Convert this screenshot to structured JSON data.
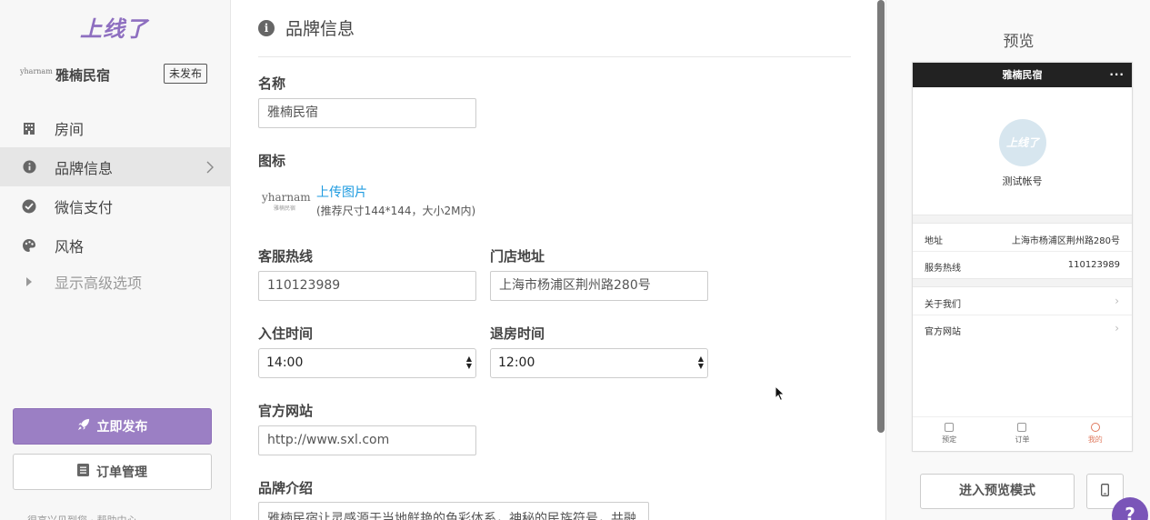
{
  "sidebar": {
    "logo": "上线了",
    "brand_mini": "yharnam",
    "brand_name": "雅楠民宿",
    "status_badge": "未发布",
    "items": [
      {
        "label": "房间",
        "icon": "building-icon"
      },
      {
        "label": "品牌信息",
        "icon": "info-icon",
        "active": true
      },
      {
        "label": "微信支付",
        "icon": "wechat-pay-icon"
      },
      {
        "label": "风格",
        "icon": "palette-icon"
      }
    ],
    "advanced_label": "显示高级选项",
    "publish_label": "立即发布",
    "orders_label": "订单管理",
    "footer_text": "很高兴见到您 · 帮助中心"
  },
  "form": {
    "section_title": "品牌信息",
    "name_label": "名称",
    "name_value": "雅楠民宿",
    "icon_label": "图标",
    "icon_thumb_text": "yharnam",
    "icon_thumb_sub": "雅楠民宿",
    "upload_label": "上传图片",
    "upload_hint": "(推荐尺寸144*144，大小2M内)",
    "hotline_label": "客服热线",
    "hotline_value": "110123989",
    "address_label": "门店地址",
    "address_value": "上海市杨浦区荆州路280号",
    "checkin_label": "入住时间",
    "checkin_value": "14:00",
    "checkout_label": "退房时间",
    "checkout_value": "12:00",
    "website_label": "官方网站",
    "website_value": "http://www.sxl.com",
    "intro_label": "品牌介绍",
    "intro_value": "雅楠民宿让灵感源于当地鲜艳的色彩体系，神秘的民族符号，共融"
  },
  "preview": {
    "title": "预览",
    "phone_title": "雅楠民宿",
    "more": "···",
    "avatar_text": "上线了",
    "account_name": "测试帐号",
    "address_key": "地址",
    "address_value": "上海市杨浦区荆州路280号",
    "hotline_key": "服务热线",
    "hotline_value": "110123989",
    "about_label": "关于我们",
    "website_label": "官方网站",
    "tabs": [
      {
        "label": "预定"
      },
      {
        "label": "订单"
      },
      {
        "label": "我的",
        "active": true
      }
    ],
    "enter_preview_label": "进入预览模式",
    "help_label": "?"
  },
  "colors": {
    "accent": "#9b7fc4",
    "link": "#1e9be0",
    "help": "#7a55b8"
  }
}
